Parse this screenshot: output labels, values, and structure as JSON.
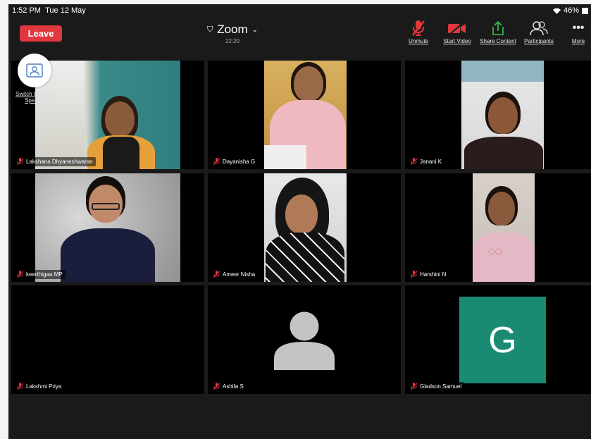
{
  "status_bar": {
    "time": "1:52 PM",
    "date": "Tue 12 May",
    "battery": "46%"
  },
  "toolbar": {
    "leave_label": "Leave",
    "title": "Zoom",
    "duration": "22:20",
    "unmute_label": "Unmute",
    "start_video_label": "Start Video",
    "share_content_label": "Share Content",
    "participants_label": "Participants",
    "more_label": "More"
  },
  "switch_speaker_label": "Switch to Active Speaker",
  "participants": [
    {
      "name": "Lakshana Dhyaneshwaran",
      "muted": true,
      "video": true
    },
    {
      "name": "Dayanisha G",
      "muted": true,
      "video": true
    },
    {
      "name": "Janani K",
      "muted": true,
      "video": true
    },
    {
      "name": "keerthigaa MP",
      "muted": true,
      "video": true
    },
    {
      "name": "Ameer Nisha",
      "muted": true,
      "video": true
    },
    {
      "name": "Harshini N",
      "muted": true,
      "video": true
    },
    {
      "name": "Lakshmi Priya",
      "muted": true,
      "video": false
    },
    {
      "name": "Ashifa S",
      "muted": true,
      "video": false,
      "avatar": "silhouette"
    },
    {
      "name": "Gladson Samuel",
      "muted": true,
      "video": false,
      "avatar_letter": "G"
    }
  ],
  "colors": {
    "leave": "#e0383e",
    "muted_icon": "#e0383e",
    "share_icon": "#3cc24a",
    "avatar_g_bg": "#1a8a72"
  }
}
